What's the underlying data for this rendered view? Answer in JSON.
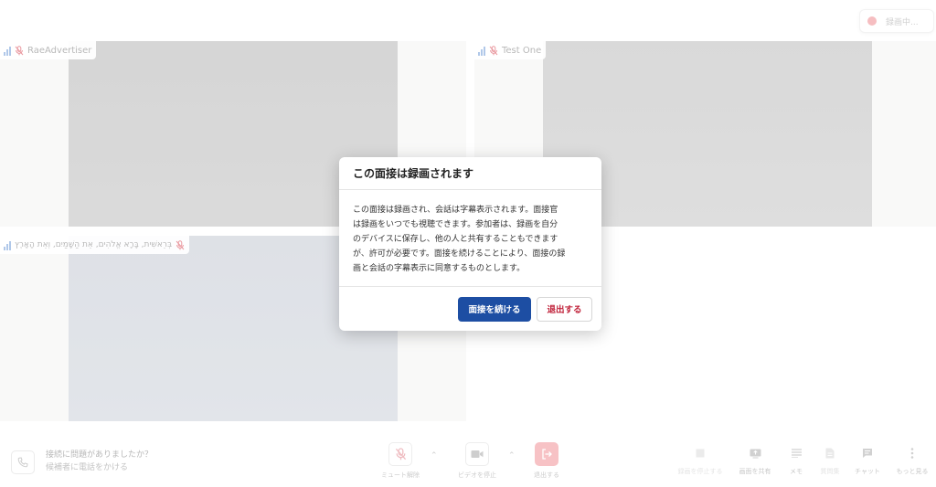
{
  "recording": {
    "label": "録画中...",
    "dot_color": "#f2a3a7"
  },
  "participants": [
    {
      "name": "RaeAdvertiser"
    },
    {
      "name": "Test One"
    },
    {
      "name": "בְּרֵאשִׁית, בָּרָא אֱלֹהִים, אֵת הַשָּׁמַיִם, וְאֵת הָאָרֶץ"
    }
  ],
  "modal": {
    "title": "この面接は録画されます",
    "body_lines": [
      "この面接は録画され、会話は字幕表示されます。面接官",
      "は録画をいつでも視聴できます。参加者は、録画を自分",
      "のデバイスに保存し、他の人と共有することもできます",
      "が、許可が必要です。面接を続けることにより、面接の録",
      "画と会話の字幕表示に同意するものとします。"
    ],
    "continue_label": "面接を続ける",
    "leave_label": "退出する",
    "primary_color": "#1d4ea3",
    "danger_color": "#c0223a"
  },
  "toolbar": {
    "help_title": "接続に問題がありましたか？",
    "help_subtitle": "候補者に電話をかける",
    "unmute_label": "ミュート解除",
    "stop_video_label": "ビデオを停止",
    "leave_label": "退出する",
    "stop_recording_label": "録画を停止する",
    "share_screen_label": "画面を共有",
    "memo_label": "メモ",
    "questions_label": "質問集",
    "chat_label": "チャット",
    "more_label": "もっと見る"
  }
}
